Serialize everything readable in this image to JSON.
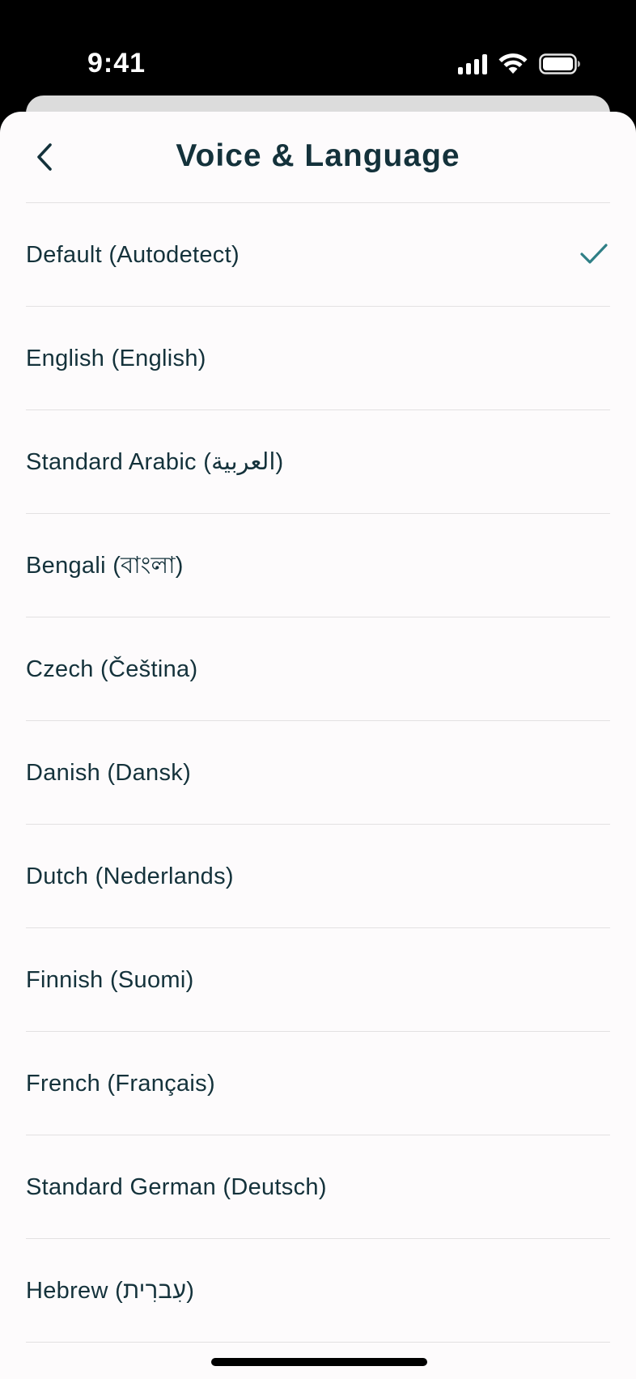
{
  "status_bar": {
    "time": "9:41",
    "icons": [
      "signal-icon",
      "wifi-icon",
      "battery-icon"
    ]
  },
  "header": {
    "title": "Voice & Language",
    "back_icon": "chevron-left-icon"
  },
  "languages": [
    {
      "label": "Default (Autodetect)",
      "selected": true
    },
    {
      "label": "English (English)",
      "selected": false
    },
    {
      "label": "Standard Arabic (العربية)",
      "selected": false
    },
    {
      "label": "Bengali (বাংলা)",
      "selected": false
    },
    {
      "label": "Czech (Čeština)",
      "selected": false
    },
    {
      "label": "Danish (Dansk)",
      "selected": false
    },
    {
      "label": "Dutch (Nederlands)",
      "selected": false
    },
    {
      "label": "Finnish (Suomi)",
      "selected": false
    },
    {
      "label": "French (Français)",
      "selected": false
    },
    {
      "label": "Standard German (Deutsch)",
      "selected": false
    },
    {
      "label": "Hebrew (עִברִית)",
      "selected": false
    }
  ],
  "colors": {
    "text": "#14323b",
    "accent": "#2f7f86",
    "divider": "#e3e1e2",
    "background": "#fdfbfc"
  }
}
